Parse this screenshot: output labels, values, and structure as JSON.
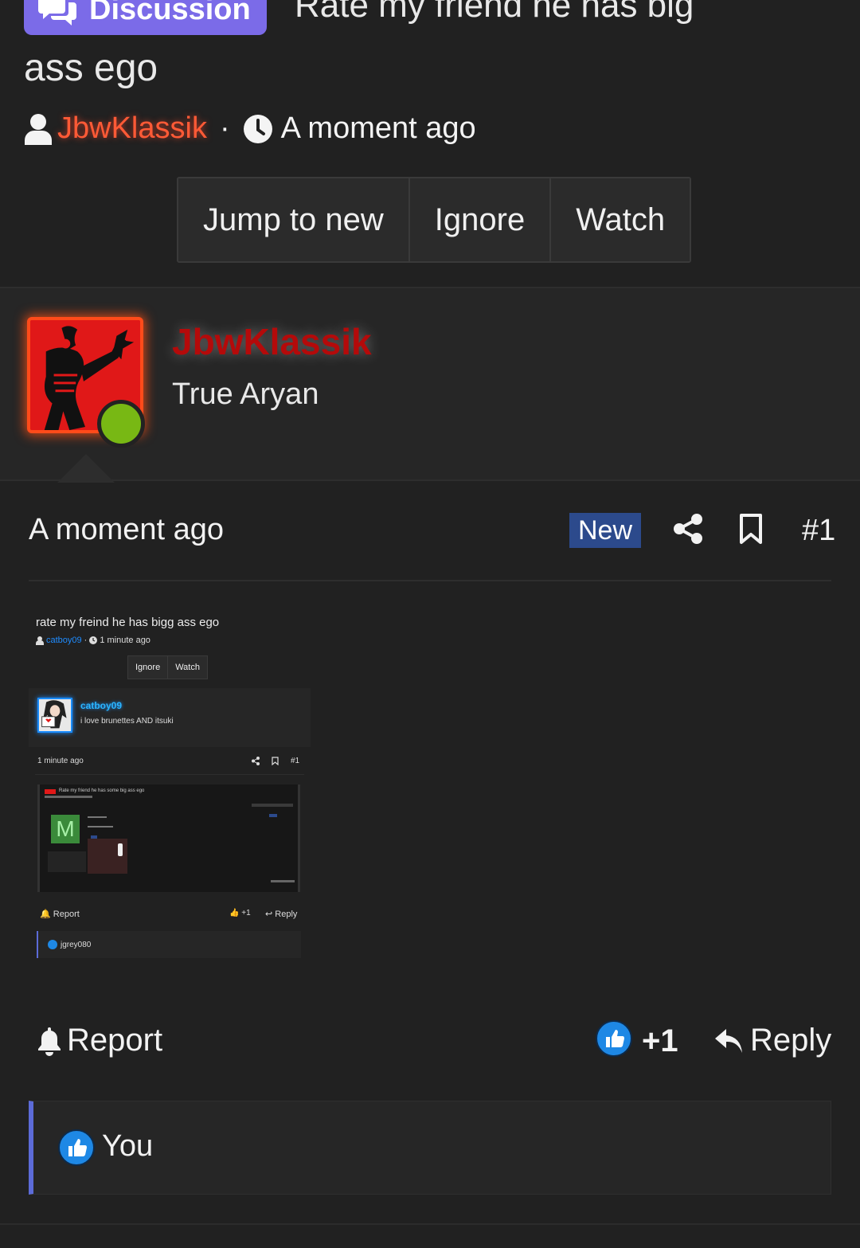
{
  "thread": {
    "prefix_label": "Discussion",
    "title_line1": "Rate my friend he has big",
    "title_line2": "ass ego",
    "author": "JbwKlassik",
    "separator": "·",
    "time": "A moment ago",
    "buttons": {
      "jump": "Jump to new",
      "ignore": "Ignore",
      "watch": "Watch"
    }
  },
  "post": {
    "username": "JbwKlassik",
    "user_title": "True Aryan",
    "time": "A moment ago",
    "new_badge": "New",
    "number": "#1",
    "footer": {
      "report": "Report",
      "like_count": "+1",
      "reply": "Reply"
    },
    "reactions": {
      "user": "You"
    }
  },
  "embedded_screenshot": {
    "title": "rate my freind he has bigg ass ego",
    "author": "catboy09",
    "time": "1 minute ago",
    "buttons": {
      "ignore": "Ignore",
      "watch": "Watch"
    },
    "username": "catboy09",
    "user_title": "i love brunettes AND itsuki",
    "post_time": "1 minute ago",
    "post_number": "#1",
    "nested_title": "Rate my friend he has some big ass ego",
    "nested_avatar_letter": "M",
    "report": "Report",
    "like": "+1",
    "reply": "Reply",
    "reaction_user": "jgrey080"
  },
  "colors": {
    "background": "#212121",
    "discussion_label": "#7b6be8",
    "author_orange": "#ff5a36",
    "username_red": "#b40a0a",
    "new_badge": "#2c4a8c",
    "online": "#78b814",
    "like_blue": "#1e88e5",
    "reaction_border": "#5c6bd8"
  },
  "icons": [
    "chat-bubbles-icon",
    "user-icon",
    "clock-icon",
    "share-icon",
    "bookmark-icon",
    "bell-icon",
    "thumbs-up-icon",
    "reply-arrow-icon"
  ]
}
